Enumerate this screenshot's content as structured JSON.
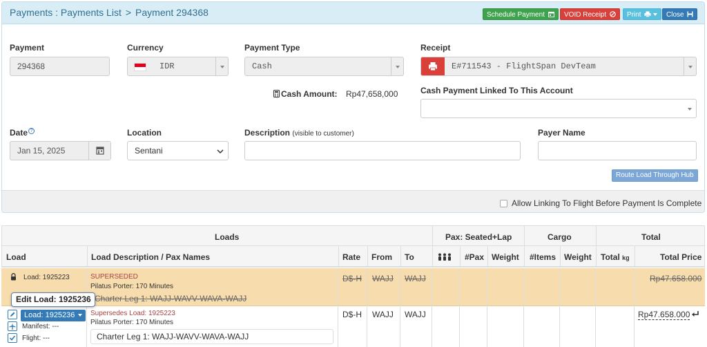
{
  "header": {
    "breadcrumb_list": "Payments : Payments List",
    "breadcrumb_sep": ">",
    "breadcrumb_current": "Payment 294368",
    "btn_schedule": "Schedule Payment",
    "btn_void": "VOID Receipt",
    "btn_print": "Print",
    "btn_close": "Close"
  },
  "form": {
    "payment_label": "Payment",
    "payment_value": "294368",
    "currency_label": "Currency",
    "currency_value": "IDR",
    "payment_type_label": "Payment Type",
    "payment_type_value": "Cash",
    "receipt_label": "Receipt",
    "receipt_value": "E#711543 - FlightSpan DevTeam",
    "cash_amount_label": "Cash Amount:",
    "cash_amount_value": "Rp47,658,000",
    "linked_account_label": "Cash Payment Linked To This Account",
    "linked_account_value": "",
    "date_label": "Date",
    "date_value": "Jan 15, 2025",
    "location_label": "Location",
    "location_value": "Sentani",
    "description_label": "Description",
    "description_hint": "(visible to customer)",
    "description_value": "",
    "payer_label": "Payer Name",
    "payer_value": "",
    "route_btn": "Route Load Through Hub",
    "allow_linking_label": "Allow Linking To Flight Before Payment Is Complete"
  },
  "table": {
    "group_headers": {
      "loads": "Loads",
      "pax": "Pax: Seated+Lap",
      "cargo": "Cargo",
      "total": "Total"
    },
    "columns": {
      "load": "Load",
      "description": "Load Description / Pax Names",
      "rate": "Rate",
      "from": "From",
      "to": "To",
      "pax": "#Pax",
      "pax_weight": "Weight",
      "items": "#Items",
      "cargo_weight": "Weight",
      "total_kg": "Total",
      "total_kg_unit": "kg",
      "total_price": "Total Price"
    },
    "rows": [
      {
        "load": "Load: 1925223",
        "status": "SUPERSEDED",
        "aircraft": "Pilatus Porter: 170 Minutes",
        "leg": "Charter Leg 1: WAJJ-WAVV-WAVA-WAJJ",
        "rate": "D$-H",
        "from": "WAJJ",
        "to": "WAJJ",
        "total_price": "Rp47.658.000"
      },
      {
        "load": "Load: 1925236",
        "status": "Supersedes Load: 1925223",
        "aircraft": "Pilatus Porter: 170 Minutes",
        "leg": "Charter Leg 1: WAJJ-WAVV-WAVA-WAJJ",
        "manifest": "Manifest: ---",
        "flight": "Flight: ---",
        "rate": "D$-H",
        "from": "WAJJ",
        "to": "WAJJ",
        "total_price": "Rp47.658.000"
      }
    ],
    "tooltip": "Edit Load: 1925236"
  }
}
